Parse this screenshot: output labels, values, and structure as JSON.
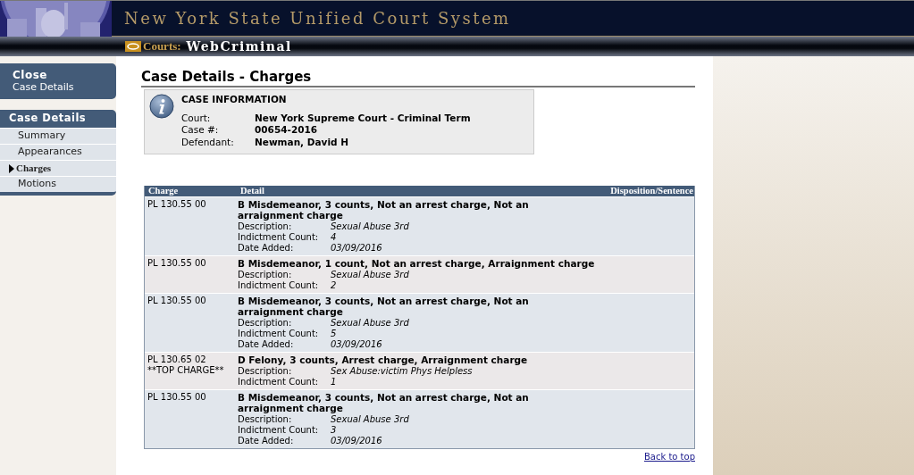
{
  "header": {
    "title": "New York State Unified Court System",
    "logo_label": "Courts:",
    "app_name": "WebCriminal"
  },
  "sidebar": {
    "close": {
      "title": "Close",
      "subtitle": "Case Details"
    },
    "section_title": "Case Details",
    "items": [
      {
        "label": "Summary",
        "selected": false
      },
      {
        "label": "Appearances",
        "selected": false
      },
      {
        "label": "Charges",
        "selected": true
      },
      {
        "label": "Motions",
        "selected": false
      }
    ]
  },
  "page_title": "Case Details - Charges",
  "case_information": {
    "heading": "CASE INFORMATION",
    "fields": [
      {
        "label": "Court:",
        "value": "New York Supreme Court - Criminal Term"
      },
      {
        "label": "Case #:",
        "value": "00654-2016"
      },
      {
        "label": "Defendant:",
        "value": "Newman, David H"
      }
    ]
  },
  "table": {
    "columns": [
      "Charge",
      "Detail",
      "Disposition/Sentence"
    ],
    "rows": [
      {
        "charge": "PL 130.55 00",
        "detail": "B Misdemeanor, 3 counts, Not an arrest charge, Not an arraignment charge",
        "fields": [
          {
            "label": "Description:",
            "value": "Sexual Abuse 3rd"
          },
          {
            "label": "Indictment Count:",
            "value": "4"
          },
          {
            "label": "Date Added:",
            "value": "03/09/2016"
          }
        ]
      },
      {
        "charge": "PL 130.55 00",
        "detail": "B Misdemeanor, 1 count, Not an arrest charge, Arraignment charge",
        "fields": [
          {
            "label": "Description:",
            "value": "Sexual Abuse 3rd"
          },
          {
            "label": "Indictment Count:",
            "value": "2"
          }
        ]
      },
      {
        "charge": "PL 130.55 00",
        "detail": "B Misdemeanor, 3 counts, Not an arrest charge, Not an arraignment charge",
        "fields": [
          {
            "label": "Description:",
            "value": "Sexual Abuse 3rd"
          },
          {
            "label": "Indictment Count:",
            "value": "5"
          },
          {
            "label": "Date Added:",
            "value": "03/09/2016"
          }
        ]
      },
      {
        "charge": "PL 130.65 02",
        "note": "**TOP CHARGE**",
        "detail": "D Felony, 3 counts, Arrest charge, Arraignment charge",
        "fields": [
          {
            "label": "Description:",
            "value": "Sex Abuse:victim Phys Helpless"
          },
          {
            "label": "Indictment Count:",
            "value": "1"
          }
        ]
      },
      {
        "charge": "PL 130.55 00",
        "detail": "B Misdemeanor, 3 counts, Not an arrest charge, Not an arraignment charge",
        "fields": [
          {
            "label": "Description:",
            "value": "Sexual Abuse 3rd"
          },
          {
            "label": "Indictment Count:",
            "value": "3"
          },
          {
            "label": "Date Added:",
            "value": "03/09/2016"
          }
        ]
      }
    ]
  },
  "back_to_top": "Back to top"
}
